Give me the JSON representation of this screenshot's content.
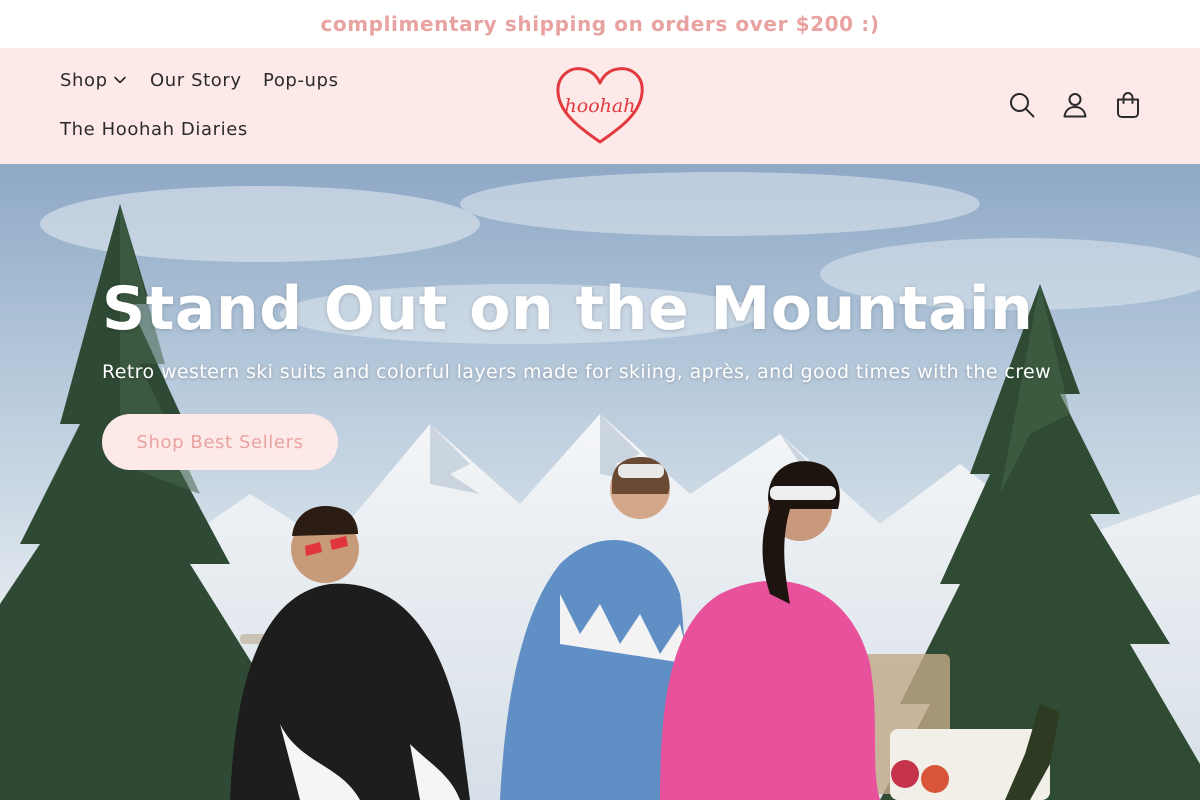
{
  "announcement": {
    "text": "complimentary shipping on orders over $200 :)"
  },
  "header": {
    "nav": {
      "shop": "Shop",
      "our_story": "Our Story",
      "popups": "Pop-ups",
      "diaries": "The Hoohah Diaries"
    },
    "logo": {
      "text": "hoohah",
      "icon": "heart-logo-icon"
    },
    "icons": [
      "search-icon",
      "account-icon",
      "cart-icon"
    ]
  },
  "hero": {
    "title": "Stand Out on the Mountain",
    "subtitle": "Retro western ski suits and colorful layers made for skiing, après, and good times with the crew",
    "cta_label": "Shop Best Sellers"
  },
  "colors": {
    "announcement_text": "#e8a3a1",
    "header_bg": "#fde9e8",
    "logo_red": "#e23a3f",
    "button_bg": "#fde9e8",
    "button_text": "#e8a3a1"
  }
}
